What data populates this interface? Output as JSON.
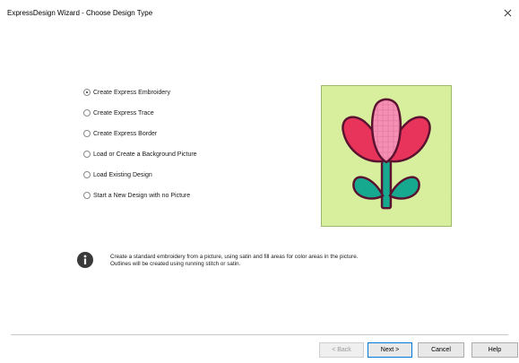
{
  "window": {
    "title": "ExpressDesign Wizard - Choose Design Type"
  },
  "options": [
    {
      "label": "Create Express Embroidery",
      "selected": true
    },
    {
      "label": "Create Express Trace",
      "selected": false
    },
    {
      "label": "Create Express Border",
      "selected": false
    },
    {
      "label": "Load or Create a Background Picture",
      "selected": false
    },
    {
      "label": "Load Existing Design",
      "selected": false
    },
    {
      "label": "Start a New Design with no Picture",
      "selected": false
    }
  ],
  "description": {
    "line1": "Create a standard embroidery from a picture, using satin and fill areas for color areas in the picture.",
    "line2": "Outlines will be created using running stitch or satin."
  },
  "buttons": {
    "back": "< Back",
    "next": "Next >",
    "cancel": "Cancel",
    "help": "Help"
  },
  "colors": {
    "preview_bg": "#d7ef9c",
    "petal_red": "#e8335a",
    "petal_pink": "#f58fb3",
    "leaf_teal": "#17a98f",
    "outline": "#5a1230",
    "accent": "#0078d7"
  },
  "icons": {
    "close": "close-icon",
    "info": "info-icon"
  }
}
